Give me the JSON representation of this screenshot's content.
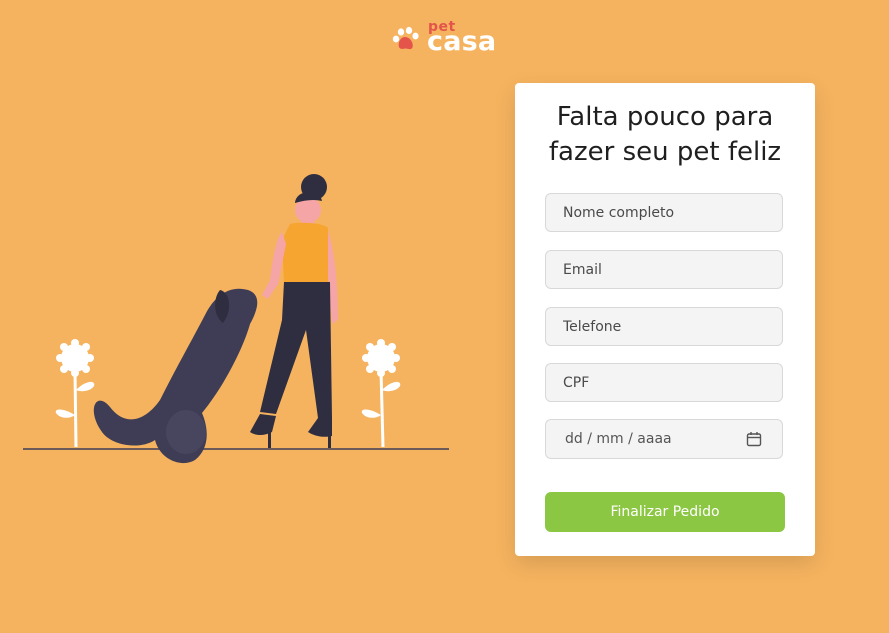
{
  "brand": {
    "logo_small": "pet",
    "logo_main": "casa",
    "colors": {
      "primary_red": "#e4544a",
      "white": "#ffffff"
    }
  },
  "page": {
    "background": "#f5b35f"
  },
  "form": {
    "title_line1": "Falta pouco para",
    "title_line2": "fazer seu pet feliz",
    "fields": {
      "name_placeholder": "Nome completo",
      "email_placeholder": "Email",
      "phone_placeholder": "Telefone",
      "cpf_placeholder": "CPF",
      "date_placeholder": "dd / mm / aaaa"
    },
    "submit_label": "Finalizar Pedido",
    "submit_color": "#8cc744"
  },
  "icons": {
    "paw": "paw-icon",
    "calendar": "calendar-icon"
  }
}
